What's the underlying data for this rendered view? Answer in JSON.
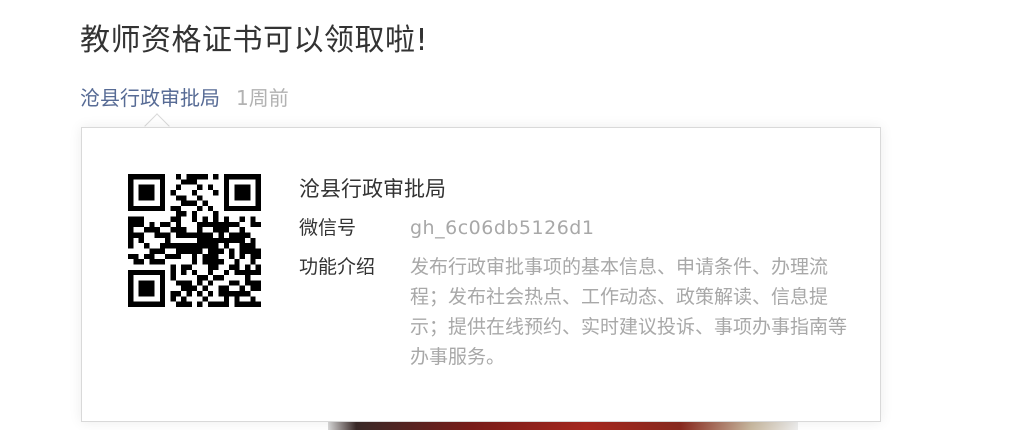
{
  "article": {
    "title": "教师资格证书可以领取啦!",
    "account_name": "沧县行政审批局",
    "publish_time": "1周前"
  },
  "profile_card": {
    "account_name": "沧县行政审批局",
    "wechat_id_label": "微信号",
    "wechat_id": "gh_6c06db5126d1",
    "intro_label": "功能介绍",
    "intro_text": "发布行政审批事项的基本信息、申请条件、办理流程；发布社会热点、工作动态、政策解读、信息提示；提供在线预约、实时建议投诉、事项办事指南等办事服务。",
    "qr_code_icon": "qr-code"
  },
  "colors": {
    "link": "#576b95",
    "muted": "#b2b2b2",
    "text": "#333333",
    "border": "#d9d9d9"
  }
}
